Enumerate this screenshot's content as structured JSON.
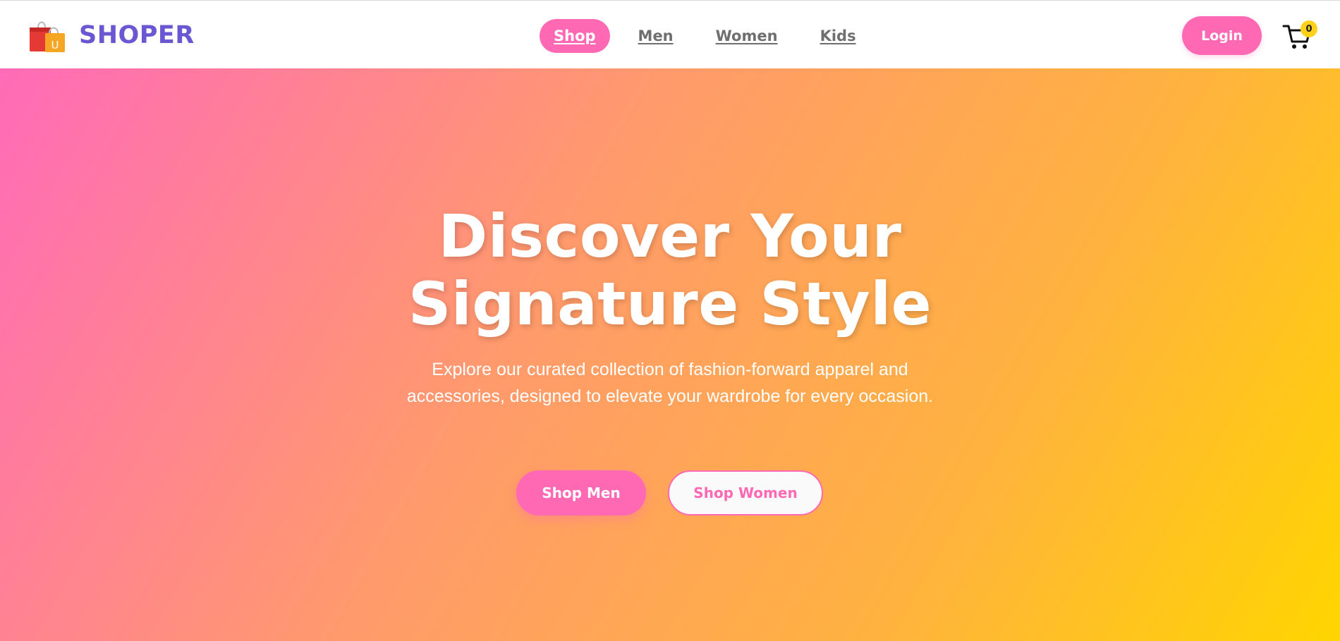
{
  "brand": {
    "name": "SHOPER",
    "logo_letter": "U"
  },
  "nav": {
    "items": [
      {
        "label": "Shop",
        "active": true
      },
      {
        "label": "Men",
        "active": false
      },
      {
        "label": "Women",
        "active": false
      },
      {
        "label": "Kids",
        "active": false
      }
    ]
  },
  "header": {
    "login_label": "Login",
    "cart_count": "0",
    "cart_icon": "cart-icon"
  },
  "hero": {
    "title_line1": "Discover Your",
    "title_line2": "Signature Style",
    "subtitle": "Explore our curated collection of fashion-forward apparel and accessories, designed to elevate your wardrobe for every occasion.",
    "cta_primary": "Shop Men",
    "cta_secondary": "Shop Women"
  },
  "colors": {
    "brand_purple": "#6a57d2",
    "accent_pink": "#ff69b4",
    "gradient_start": "#ff6bb8",
    "gradient_end": "#ffd500",
    "badge_yellow": "#ffd11a"
  }
}
